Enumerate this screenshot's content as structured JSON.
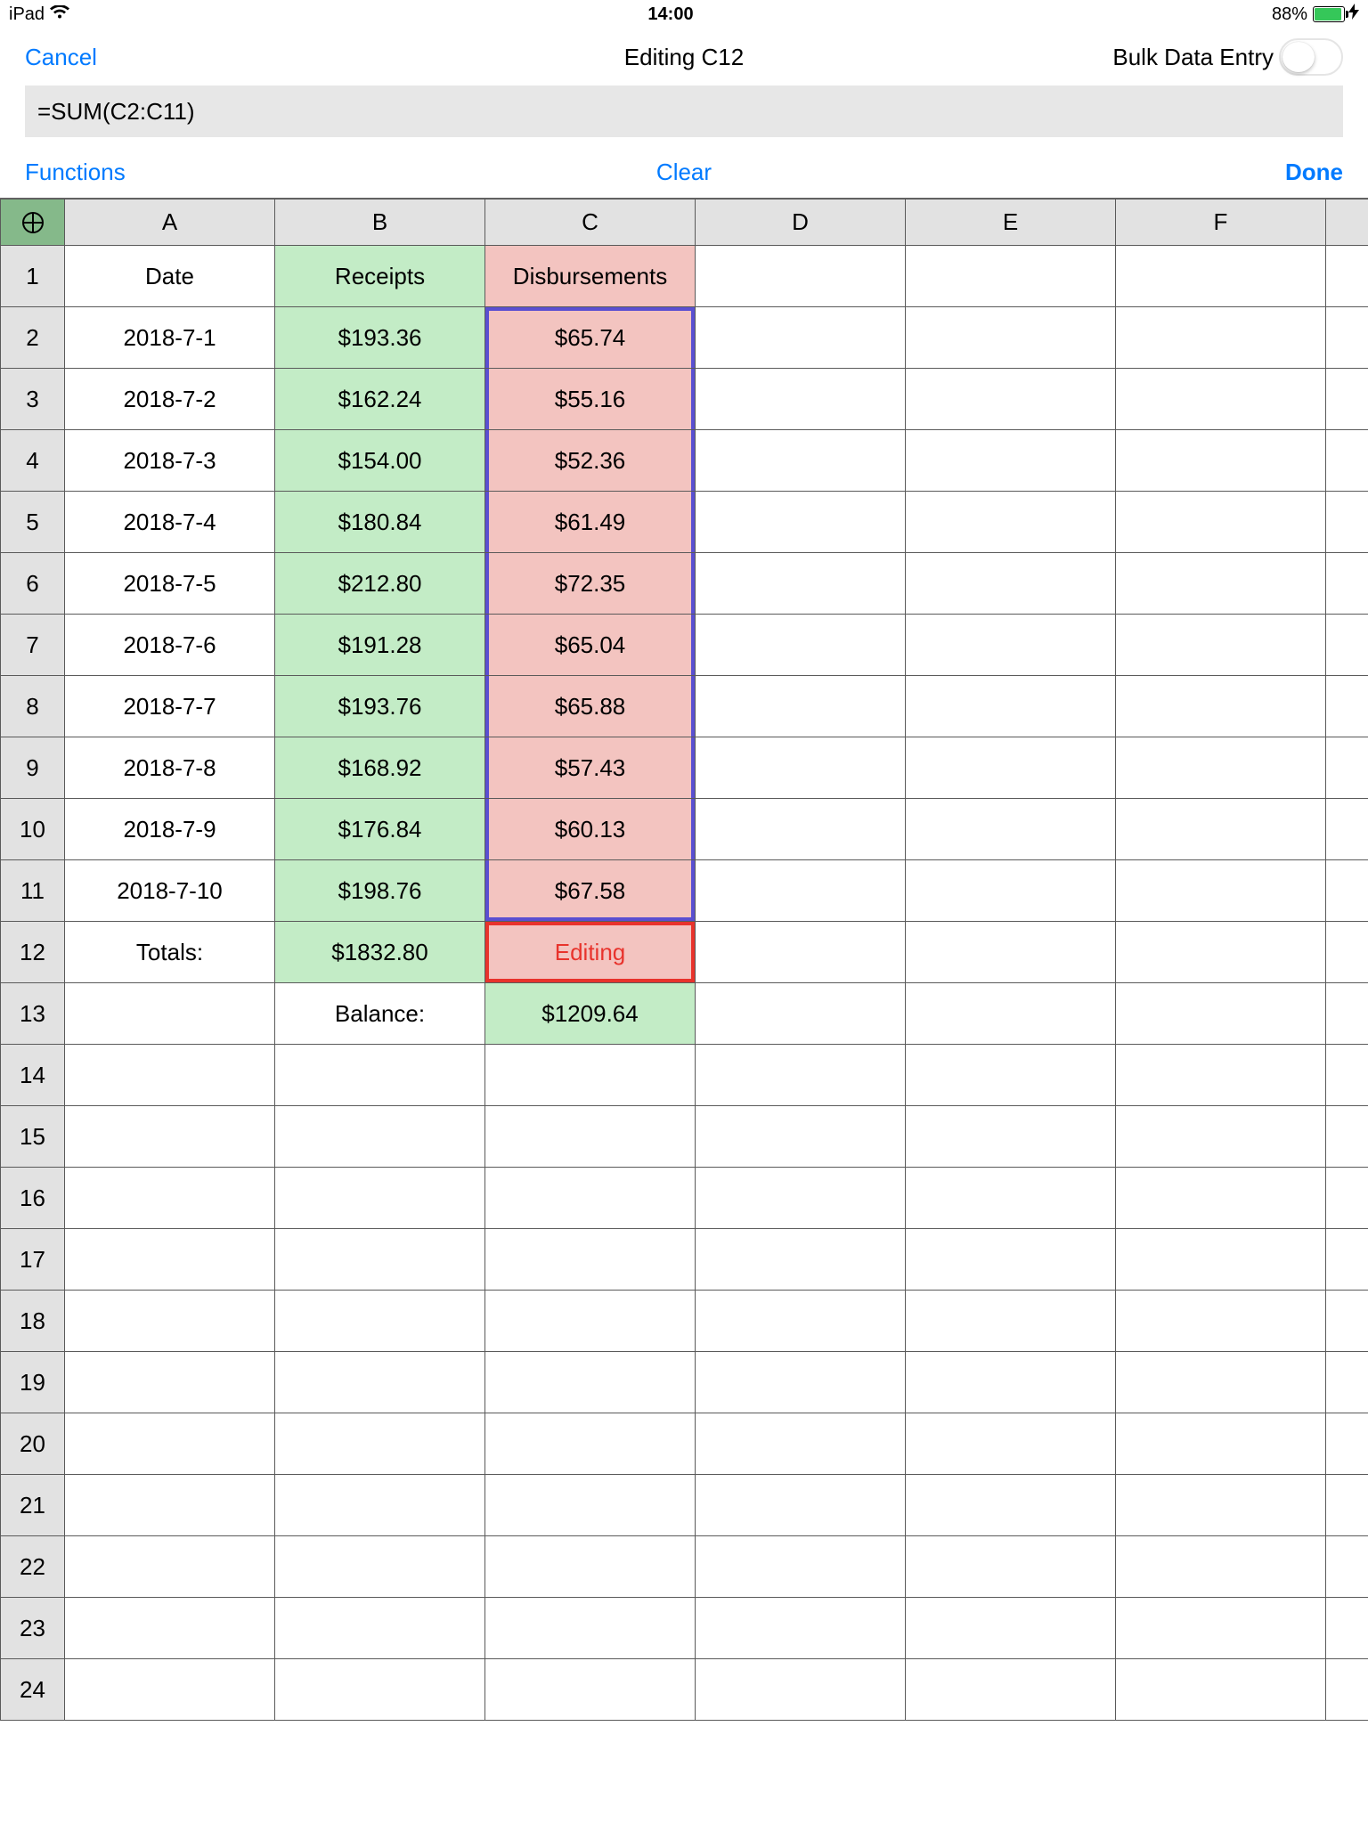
{
  "status": {
    "device": "iPad",
    "time": "14:00",
    "battery_pct": "88%"
  },
  "nav": {
    "cancel": "Cancel",
    "title": "Editing C12",
    "bulk_label": "Bulk Data Entry"
  },
  "formula": {
    "value": "=SUM(C2:C11)"
  },
  "toolbar": {
    "functions": "Functions",
    "clear": "Clear",
    "done": "Done"
  },
  "columns": [
    "A",
    "B",
    "C",
    "D",
    "E",
    "F"
  ],
  "row_headers": [
    "1",
    "2",
    "3",
    "4",
    "5",
    "6",
    "7",
    "8",
    "9",
    "10",
    "11",
    "12",
    "13",
    "14",
    "15",
    "16",
    "17",
    "18",
    "19",
    "20",
    "21",
    "22",
    "23",
    "24"
  ],
  "headers": {
    "A": "Date",
    "B": "Receipts",
    "C": "Disbursements"
  },
  "rows": [
    {
      "A": "2018-7-1",
      "B": "$193.36",
      "C": "$65.74"
    },
    {
      "A": "2018-7-2",
      "B": "$162.24",
      "C": "$55.16"
    },
    {
      "A": "2018-7-3",
      "B": "$154.00",
      "C": "$52.36"
    },
    {
      "A": "2018-7-4",
      "B": "$180.84",
      "C": "$61.49"
    },
    {
      "A": "2018-7-5",
      "B": "$212.80",
      "C": "$72.35"
    },
    {
      "A": "2018-7-6",
      "B": "$191.28",
      "C": "$65.04"
    },
    {
      "A": "2018-7-7",
      "B": "$193.76",
      "C": "$65.88"
    },
    {
      "A": "2018-7-8",
      "B": "$168.92",
      "C": "$57.43"
    },
    {
      "A": "2018-7-9",
      "B": "$176.84",
      "C": "$60.13"
    },
    {
      "A": "2018-7-10",
      "B": "$198.76",
      "C": "$67.58"
    }
  ],
  "totals": {
    "label": "Totals:",
    "B": "$1832.80",
    "C_editing": "Editing"
  },
  "balance": {
    "label": "Balance:",
    "C": "$1209.64"
  }
}
